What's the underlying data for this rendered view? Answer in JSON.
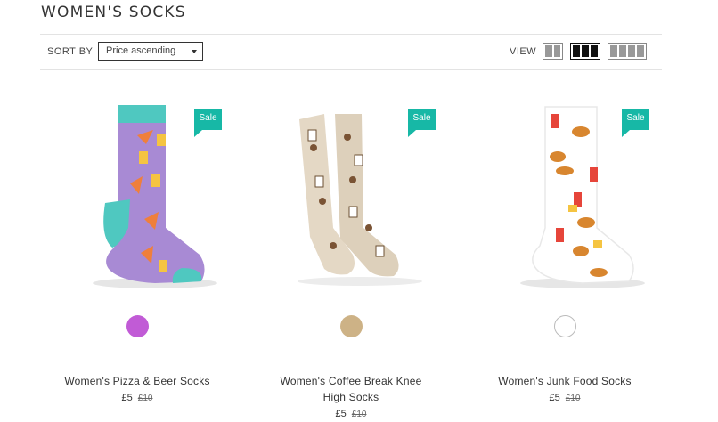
{
  "page": {
    "title": "WOMEN'S SOCKS"
  },
  "toolbar": {
    "sort_label": "SORT BY",
    "sort_value": "Price ascending",
    "view_label": "VIEW"
  },
  "products": [
    {
      "name": "Women's Pizza & Beer Socks",
      "name_line2": "",
      "sale": "Sale",
      "price": "£5",
      "old_price": "£10",
      "swatch_color": "#c15bd6"
    },
    {
      "name": "Women's Coffee Break Knee",
      "name_line2": "High Socks",
      "sale": "Sale",
      "price": "£5",
      "old_price": "£10",
      "swatch_color": "#cdb286"
    },
    {
      "name": "Women's Junk Food Socks",
      "name_line2": "",
      "sale": "Sale",
      "price": "£5",
      "old_price": "£10",
      "swatch_color": "#ffffff"
    }
  ]
}
